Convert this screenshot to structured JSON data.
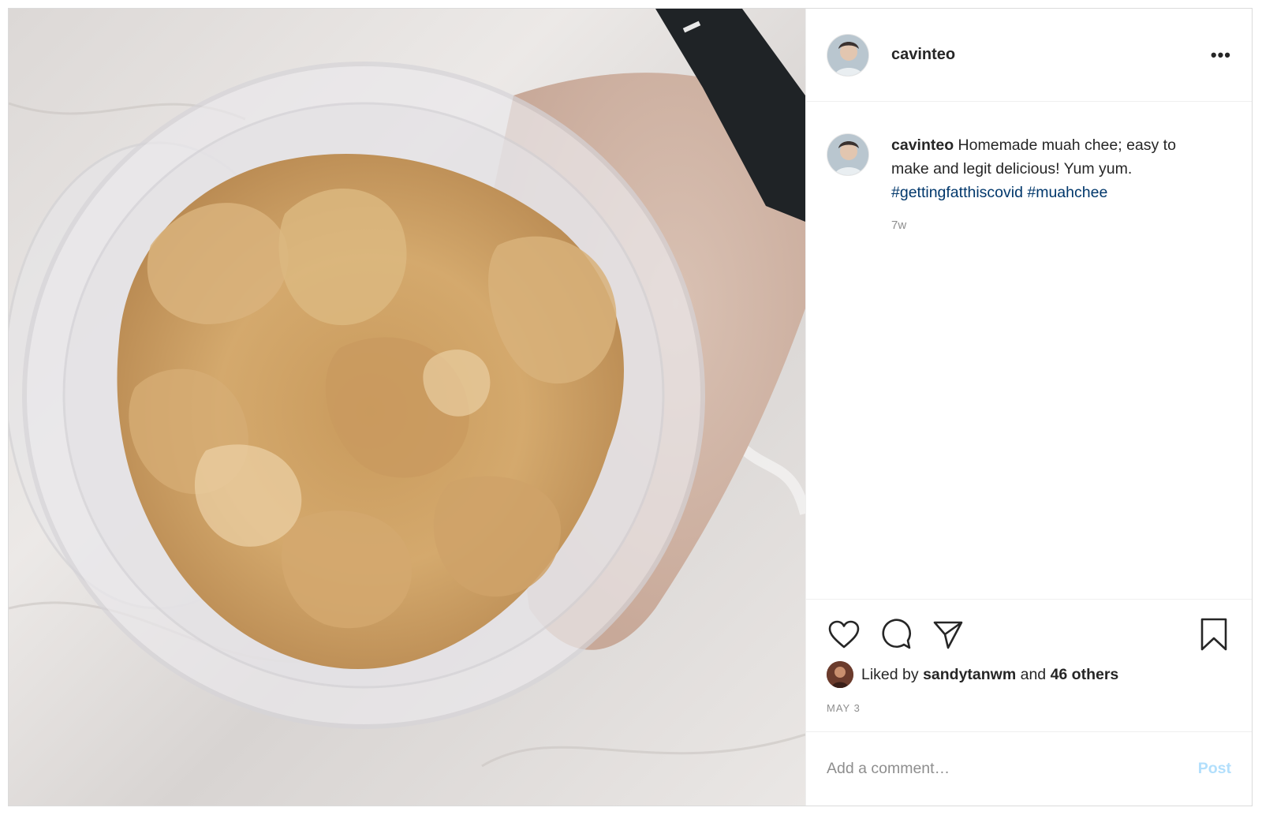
{
  "post": {
    "username": "cavinteo",
    "more_label": "•••",
    "caption": {
      "username": "cavinteo",
      "text": "Homemade muah chee; easy to make and legit delicious! Yum yum.",
      "hashtags": [
        "#gettingfatthiscovid",
        "#muahchee"
      ],
      "time_ago": "7w"
    },
    "actions": {
      "icons": [
        "heart-icon",
        "comment-icon",
        "share-icon",
        "bookmark-icon"
      ]
    },
    "likes": {
      "prefix": "Liked by",
      "user": "sandytanwm",
      "middle": "and",
      "others": "46 others"
    },
    "date": "MAY 3",
    "comment": {
      "placeholder": "Add a comment…",
      "post_label": "Post"
    },
    "colors": {
      "hashtag": "#00376b",
      "post_button": "#b2dffc",
      "muted": "#8e8e8e"
    }
  }
}
